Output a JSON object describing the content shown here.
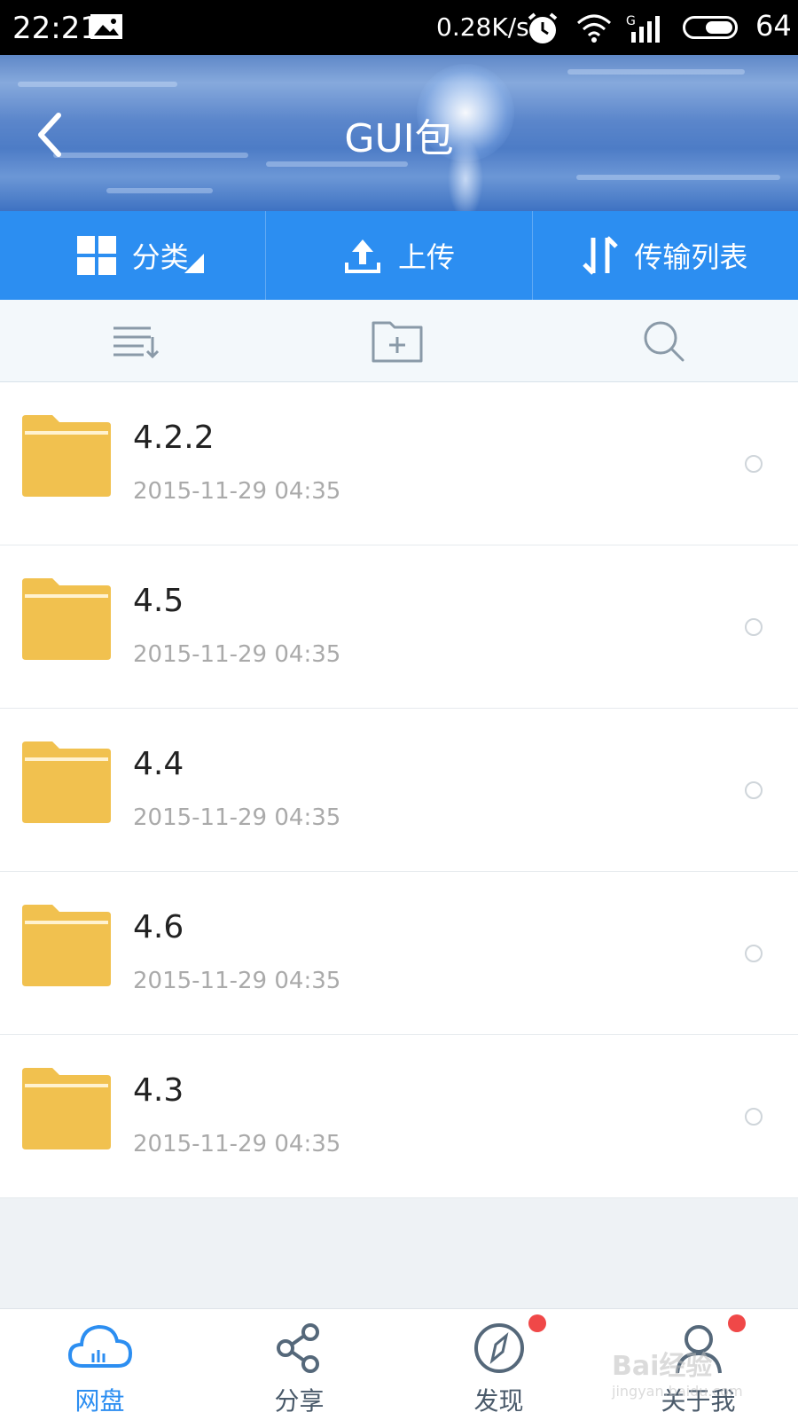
{
  "status": {
    "time": "22:21",
    "speed": "0.28K/s",
    "battery": "64"
  },
  "header": {
    "title": "GUI包"
  },
  "actions": {
    "category": "分类",
    "upload": "上传",
    "transfer": "传输列表"
  },
  "files": [
    {
      "name": "4.2.2",
      "date": "2015-11-29  04:35"
    },
    {
      "name": "4.5",
      "date": "2015-11-29  04:35"
    },
    {
      "name": "4.4",
      "date": "2015-11-29  04:35"
    },
    {
      "name": "4.6",
      "date": "2015-11-29  04:35"
    },
    {
      "name": "4.3",
      "date": "2015-11-29  04:35"
    }
  ],
  "tabs": [
    {
      "label": "网盘",
      "icon": "cloud-icon",
      "active": true
    },
    {
      "label": "分享",
      "icon": "share-icon"
    },
    {
      "label": "发现",
      "icon": "compass-icon"
    },
    {
      "label": "关于我",
      "icon": "user-icon"
    }
  ],
  "watermark": {
    "brand": "Bai经验",
    "url": "jingyan.baidu.com"
  },
  "colors": {
    "accent": "#2c8ef1",
    "folder": "#f1c14f",
    "badge": "#f04848"
  }
}
